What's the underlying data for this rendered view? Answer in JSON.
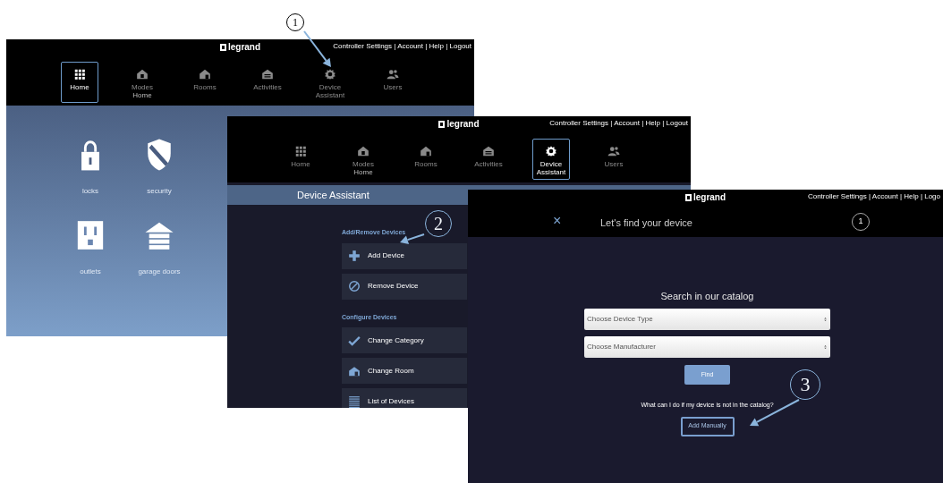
{
  "home_screen": {
    "logo": "legrand",
    "header_links": "Controller Settings | Account | Help | Logout",
    "nav": [
      {
        "label": "Home",
        "selected": true
      },
      {
        "label": "Modes",
        "sublabel": "Home",
        "selected": false
      },
      {
        "label": "Rooms",
        "selected": false
      },
      {
        "label": "Activities",
        "selected": false
      },
      {
        "label": "Device Assistant",
        "selected": false
      },
      {
        "label": "Users",
        "selected": false
      }
    ],
    "tiles": [
      "locks",
      "security",
      "outlets",
      "garage doors"
    ]
  },
  "device_assistant_screen": {
    "logo": "legrand",
    "header_links": "Controller Settings | Account | Help | Logout",
    "nav": [
      {
        "label": "Home",
        "selected": false
      },
      {
        "label": "Modes",
        "sublabel": "Home",
        "selected": false
      },
      {
        "label": "Rooms",
        "selected": false
      },
      {
        "label": "Activities",
        "selected": false
      },
      {
        "label": "Device Assistant",
        "selected": true
      },
      {
        "label": "Users",
        "selected": false
      }
    ],
    "title": "Device Assistant",
    "sections": [
      {
        "heading": "Add/Remove Devices",
        "items": [
          "Add Device",
          "Remove Device"
        ]
      },
      {
        "heading": "Configure Devices",
        "items": [
          "Change Category",
          "Change Room",
          "List of Devices"
        ]
      }
    ]
  },
  "find_device_screen": {
    "logo": "legrand",
    "header_links": "Controller Settings | Account | Help | Logo",
    "close": "×",
    "title": "Let's find your device",
    "step": "1",
    "heading": "Search in our catalog",
    "selects": [
      {
        "placeholder": "Choose Device Type"
      },
      {
        "placeholder": "Choose Manufacturer"
      }
    ],
    "find_button": "Find",
    "question": "What can I do if my device is not in the catalog?",
    "manual_button": "Add Manually"
  },
  "callouts": [
    "1",
    "2",
    "3"
  ]
}
